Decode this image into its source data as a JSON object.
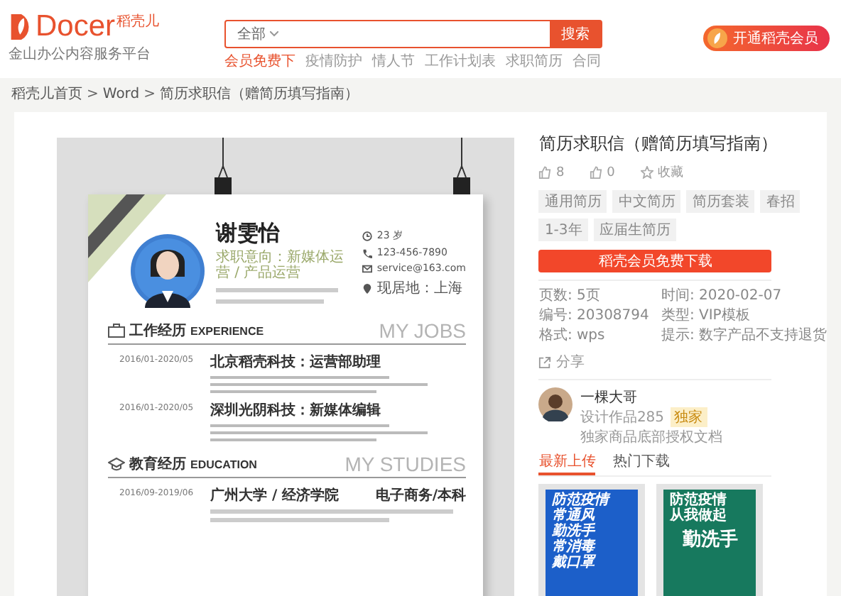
{
  "header": {
    "logo": {
      "brand": "Docer",
      "brand_cn": "稻壳儿",
      "tagline": "金山办公内容服务平台"
    },
    "search": {
      "scope": "全部",
      "button": "搜索"
    },
    "hot_words": [
      {
        "label": "会员免费下",
        "highlight": true
      },
      {
        "label": "疫情防护",
        "highlight": false
      },
      {
        "label": "情人节",
        "highlight": false
      },
      {
        "label": "工作计划表",
        "highlight": false
      },
      {
        "label": "求职简历",
        "highlight": false
      },
      {
        "label": "合同",
        "highlight": false
      }
    ],
    "vip_button": "开通稻壳会员"
  },
  "breadcrumb": {
    "separator": ">",
    "items": [
      "稻壳儿首页",
      "Word",
      "简历求职信（赠简历填写指南）"
    ]
  },
  "resume": {
    "name": "谢雯怡",
    "objective": "求职意向：新媒体运营 / 产品运营",
    "contacts": [
      {
        "kind": "age",
        "text": "23 岁"
      },
      {
        "kind": "phone",
        "text": "123-456-7890"
      },
      {
        "kind": "email",
        "text": "service@163.com"
      },
      {
        "kind": "location",
        "text": "现居地：上海"
      }
    ],
    "sections": [
      {
        "kind": "work",
        "title": "工作经历",
        "title_en": "EXPERIENCE",
        "watermark": "MY JOBS",
        "entries": [
          {
            "period": "2016/01-2020/05",
            "heading": "北京稻壳科技：运营部助理"
          },
          {
            "period": "2016/01-2020/05",
            "heading": "深圳光阴科技：新媒体编辑"
          }
        ]
      },
      {
        "kind": "education",
        "title": "教育经历",
        "title_en": "EDUCATION",
        "watermark": "MY STUDIES",
        "entries": [
          {
            "period": "2016/09-2019/06",
            "heading": "广州大学 / 经济学院",
            "degree": "电子商务/本科"
          }
        ]
      }
    ]
  },
  "detail": {
    "title": "简历求职信（赠简历填写指南）",
    "stats": [
      {
        "kind": "like",
        "text": "8"
      },
      {
        "kind": "like",
        "text": "0"
      },
      {
        "kind": "favorite",
        "text": "收藏"
      }
    ],
    "tags": [
      "通用简历",
      "中文简历",
      "简历套装",
      "春招",
      "1-3年",
      "应届生简历"
    ],
    "download_button": "稻壳会员免费下载",
    "info": [
      {
        "label": "页数:",
        "value": "5页"
      },
      {
        "label": "时间:",
        "value": "2020-02-07"
      },
      {
        "label": "编号:",
        "value": "20308794"
      },
      {
        "label": "类型:",
        "value": "VIP模板"
      },
      {
        "label": "格式:",
        "value": "wps"
      },
      {
        "label": "提示:",
        "value": "数字产品不支持退货"
      }
    ],
    "share": "分享",
    "author": {
      "name": "一棵大哥",
      "works": "设计作品285",
      "badge": "独家",
      "note": "独家商品底部授权文档"
    },
    "tabs": [
      {
        "label": "最新上传",
        "selected": true
      },
      {
        "label": "热门下载",
        "selected": false
      }
    ],
    "thumbnails": [
      {
        "kind": "blue-poster",
        "lines": [
          "防范疫情",
          "常通风",
          "勤洗手",
          "常消毒",
          "戴口罩"
        ]
      },
      {
        "kind": "green-poster",
        "lines": [
          "防范疫情",
          "从我做起",
          "勤洗手"
        ]
      }
    ]
  }
}
